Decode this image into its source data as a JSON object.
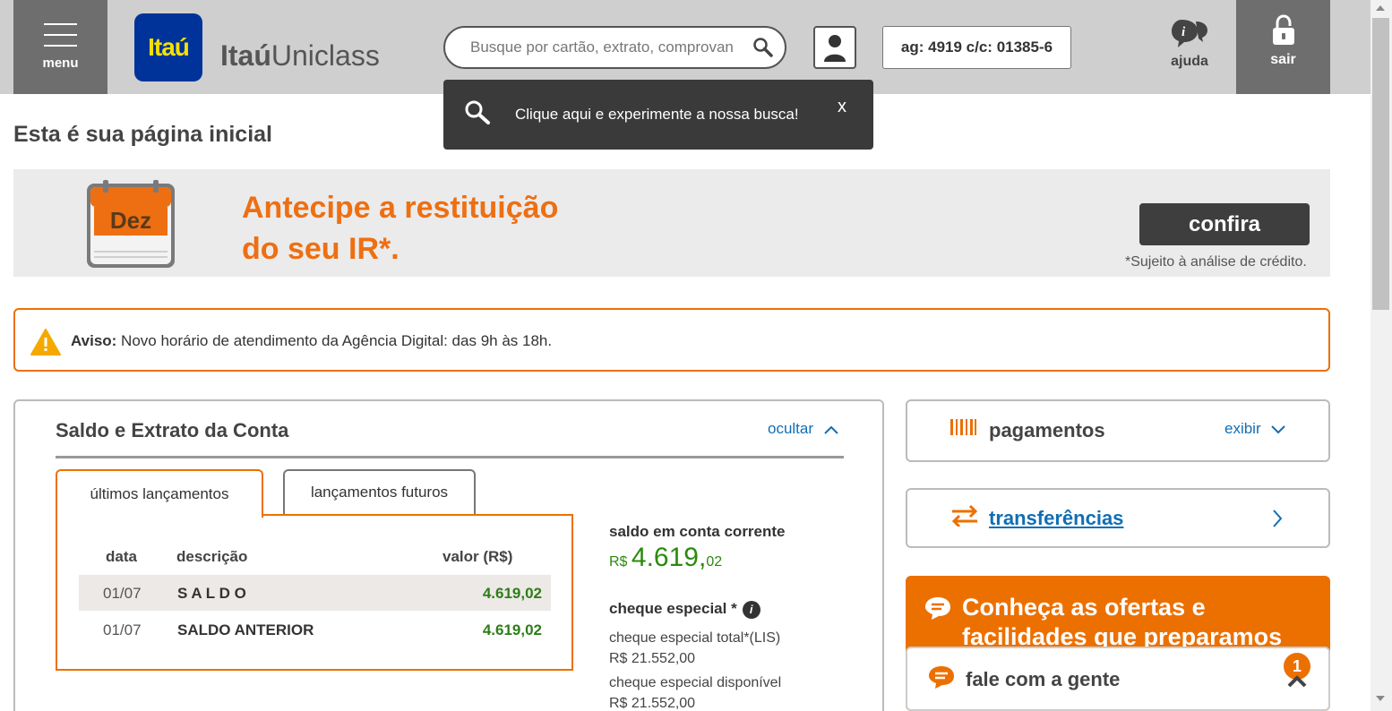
{
  "header": {
    "menu_label": "menu",
    "logo_text": "Itaú",
    "brand_bold": "Itaú",
    "brand_light": "Uniclass",
    "search_placeholder": "Busque por cartão, extrato, comprovan",
    "account_info": "ag: 4919 c/c: 01385-6",
    "help_label": "ajuda",
    "logout_label": "sair"
  },
  "tooltip": {
    "text": "Clique aqui e experimente a nossa busca!",
    "close": "x"
  },
  "page_title": "Esta é sua página inicial",
  "banner": {
    "calendar_label": "Dez",
    "headline_line1": "Antecipe a restituição",
    "headline_line2": "do seu IR*.",
    "button": "confira",
    "note": "*Sujeito à análise de crédito."
  },
  "notice": {
    "label": "Aviso:",
    "text": " Novo horário de atendimento da Agência Digital: das 9h às 18h."
  },
  "account_panel": {
    "title": "Saldo e Extrato da Conta",
    "toggle": "ocultar",
    "tabs": [
      {
        "label": "últimos lançamentos",
        "active": true
      },
      {
        "label": "lançamentos futuros",
        "active": false
      }
    ],
    "columns": [
      "data",
      "descrição",
      "valor (R$)"
    ],
    "rows": [
      {
        "date": "01/07",
        "desc": "S A L D O",
        "value": "4.619,02"
      },
      {
        "date": "01/07",
        "desc": "SALDO ANTERIOR",
        "value": "4.619,02"
      }
    ],
    "balance_label": "saldo em conta corrente",
    "balance_currency": "R$",
    "balance_integer": "4.619,",
    "balance_cents": "02",
    "overdraft_label": "cheque especial *",
    "overdraft_info_icon": "i",
    "overdraft_total_label": "cheque especial total*(LIS)",
    "overdraft_total_value": "R$ 21.552,00",
    "overdraft_available_label": "cheque especial disponível",
    "overdraft_available_value": "R$ 21.552,00"
  },
  "cards": {
    "payments_title": "pagamentos",
    "payments_toggle": "exibir",
    "transfers_title": "transferências",
    "offers_title": "Conheça as ofertas e facilidades que preparamos",
    "chat_title": "fale com a gente",
    "chat_badge": "1"
  },
  "colors": {
    "accent_orange": "#ec7000",
    "link_blue": "#106eb4",
    "positive_green": "#2e7d18",
    "header_gray": "#cfcfcf",
    "dark_gray": "#6e6e6e"
  }
}
